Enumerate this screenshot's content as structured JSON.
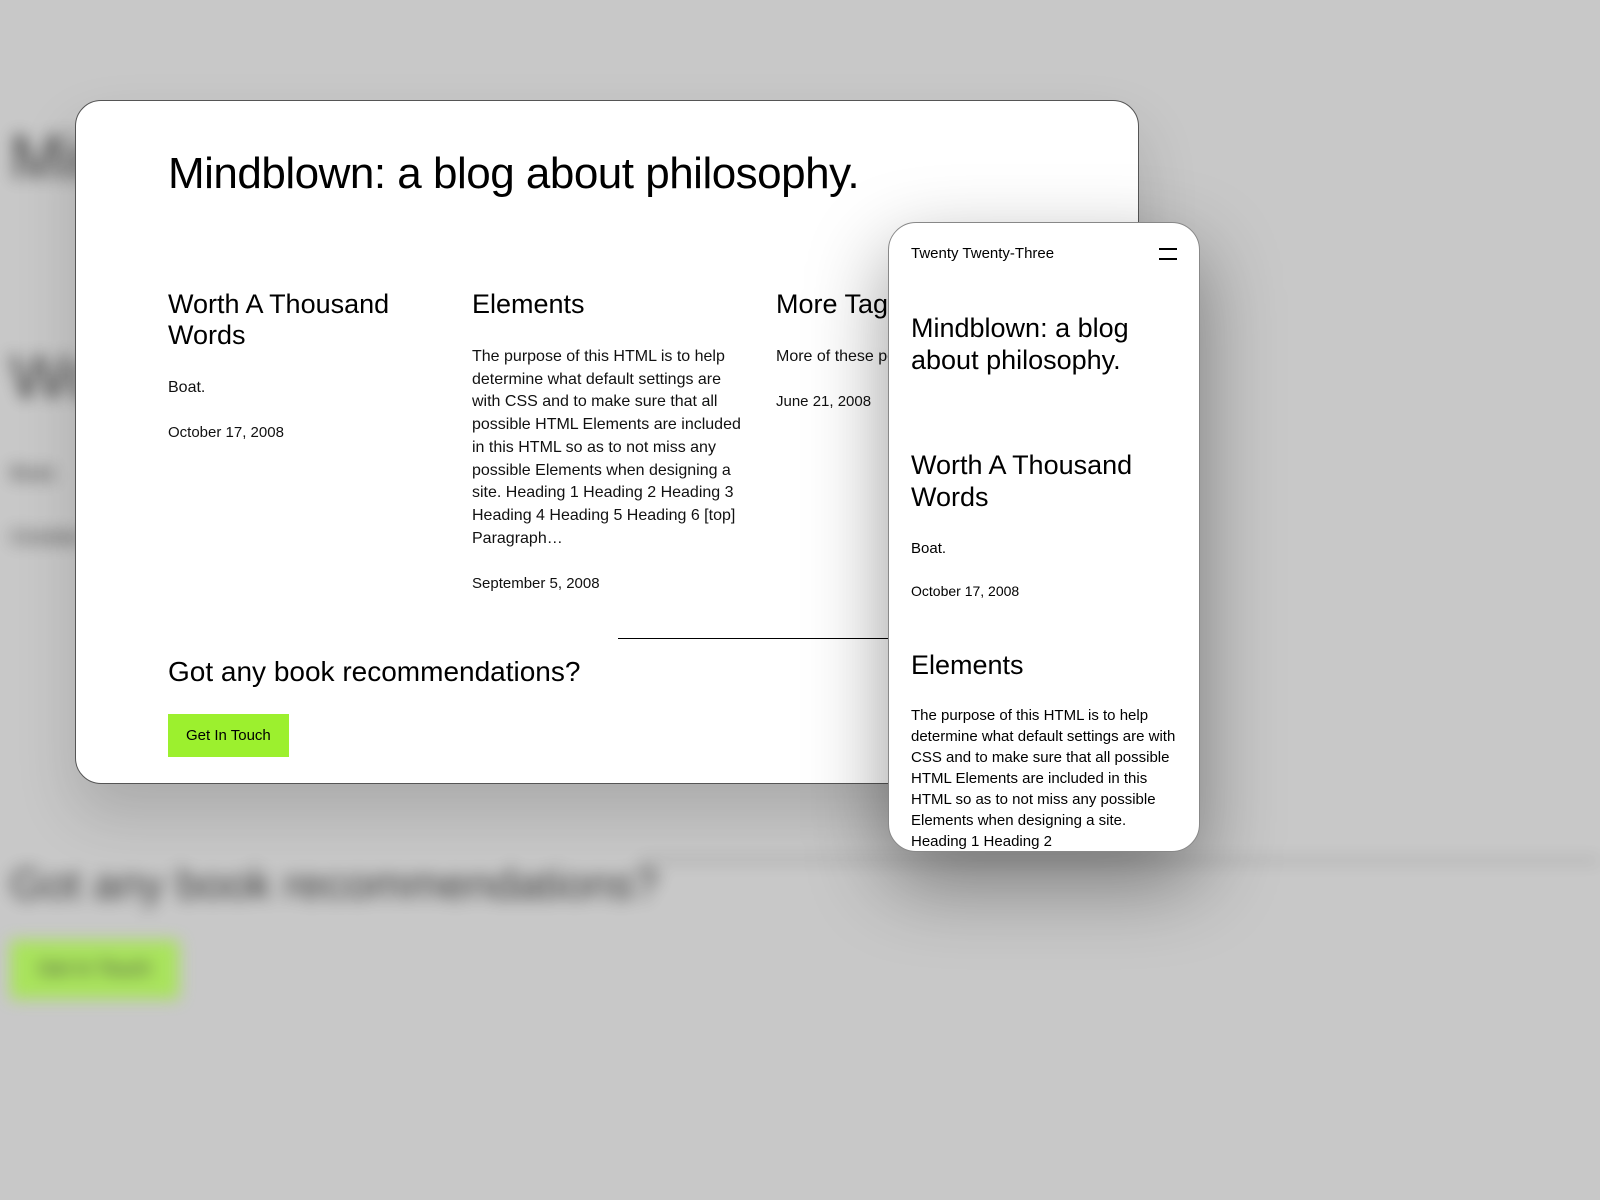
{
  "blog_title": "Mindblown: a blog about philosophy.",
  "posts": [
    {
      "title": "Worth A Thousand Words",
      "excerpt": "Boat.",
      "date": "October 17, 2008"
    },
    {
      "title": "Elements",
      "excerpt": "The purpose of this HTML is to help determine what default settings are with CSS and to make sure that all possible HTML Elements are included in this HTML so as to not miss any possible Elements when designing a site. Heading 1 Heading 2 Heading 3 Heading 4 Heading 5 Heading 6 [top] Paragraph…",
      "date": "September 5, 2008"
    },
    {
      "title": "More Tags",
      "excerpt_truncated": "More of these posts n",
      "date": "June 21, 2008"
    }
  ],
  "cta": {
    "title": "Got any book recommendations?",
    "button": "Get In Touch"
  },
  "mobile": {
    "site_title": "Twenty Twenty-Three",
    "blog_title": "Mindblown: a blog about philosophy.",
    "posts": [
      {
        "title": "Worth A Thousand Words",
        "excerpt": "Boat.",
        "date": "October 17, 2008"
      },
      {
        "title": "Elements",
        "excerpt": "The purpose of this HTML is to help determine what default settings are with CSS and to make sure that all possible HTML Elements are included in this HTML so as to not miss any possible Elements when designing a site. Heading 1 Heading 2"
      }
    ]
  },
  "colors": {
    "accent": "#9cf02e"
  }
}
